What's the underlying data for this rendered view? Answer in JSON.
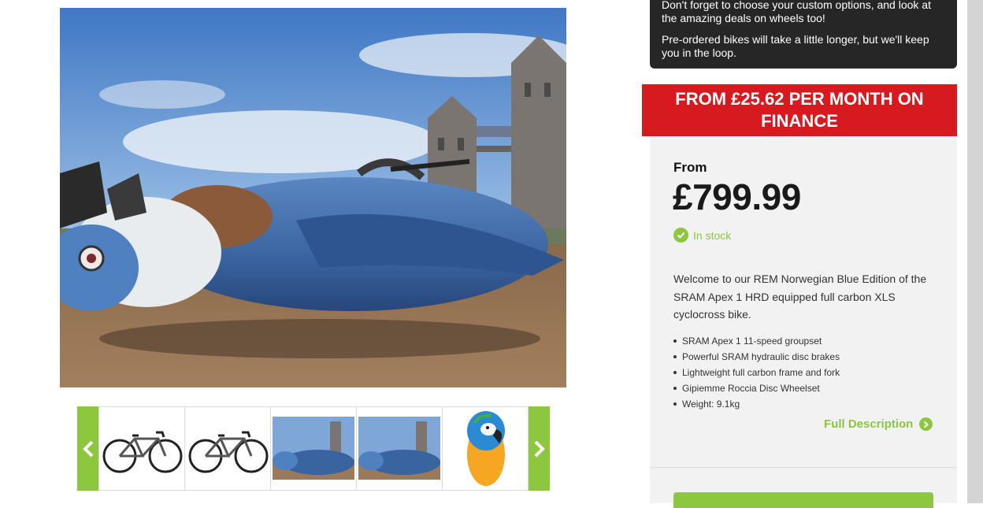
{
  "notice": {
    "line1": "Don't forget to choose your custom options, and look at the amazing deals on wheels too!",
    "line2": "Pre-ordered bikes will take a little longer, but we'll keep you in the loop."
  },
  "finance": {
    "banner": "FROM £25.62 PER MONTH ON FINANCE"
  },
  "product": {
    "from_label": "From",
    "price": "£799.99",
    "stock_status": "In stock",
    "stock_icon": "check-circle-icon",
    "description": "Welcome to our REM Norwegian Blue Edition of the SRAM Apex 1 HRD equipped full carbon XLS cyclocross bike.",
    "features": [
      "SRAM Apex 1 11-speed groupset",
      "Powerful SRAM hydraulic disc brakes",
      "Lightweight full carbon frame and fork",
      "Gipiemme Roccia Disc Wheelset",
      "Weight: 9.1kg"
    ],
    "full_description_link": "Full Description",
    "full_description_icon": "chevron-right-circle-icon"
  },
  "gallery": {
    "main_image": "giant-blue-parrot-sculpture-by-tower-bridge",
    "prev_icon": "chevron-left-icon",
    "next_icon": "chevron-right-icon",
    "thumbnails": [
      "bike-side-view",
      "bike-side-view",
      "parrot-sculpture",
      "parrot-sculpture",
      "blue-and-yellow-macaw"
    ]
  },
  "colors": {
    "accent_green": "#8dc63f",
    "banner_red": "#d71920",
    "notice_bg": "#262626"
  }
}
